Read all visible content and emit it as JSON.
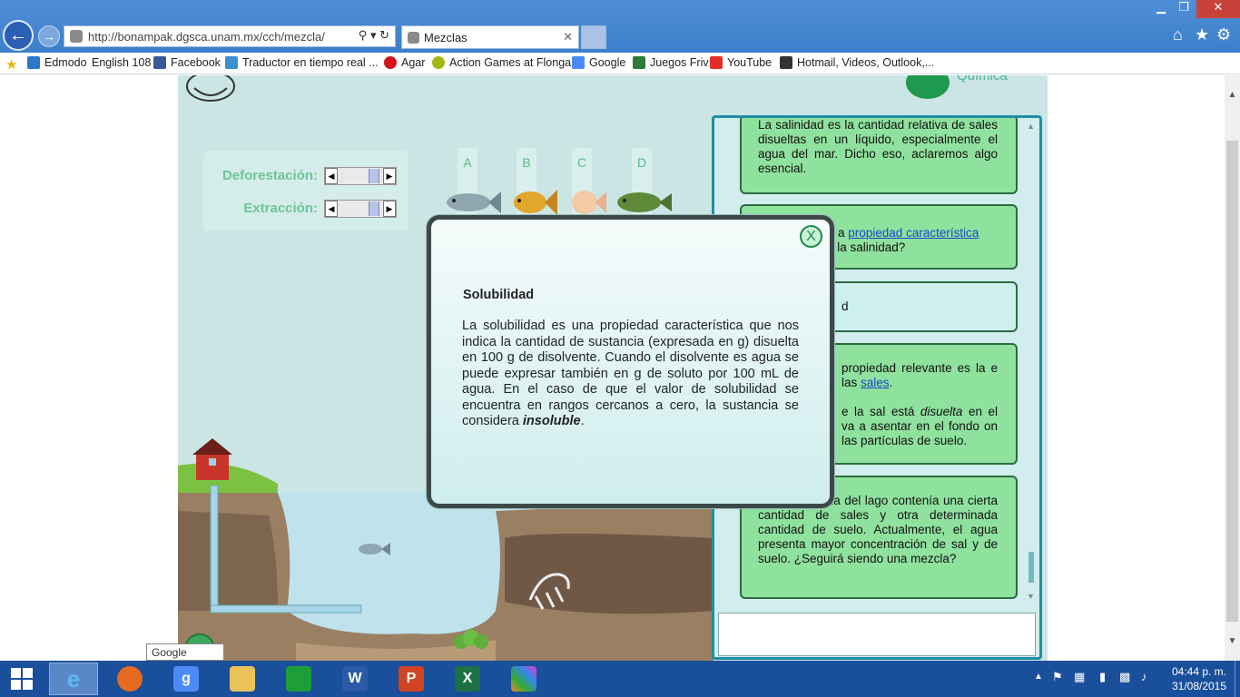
{
  "browser": {
    "address": "http://bonampak.dgsca.unam.mx/cch/mezcla/",
    "tab_title": "Mezclas",
    "window_controls": {
      "minimize": "▁",
      "maximize": "❐",
      "close": "✕"
    },
    "favorites": [
      {
        "label": "Edmodo",
        "color": "#2b76c9"
      },
      {
        "label": "English 108",
        "color": "#ffffff"
      },
      {
        "label": "Facebook",
        "color": "#3b5998"
      },
      {
        "label": "Traductor en tiempo real ...",
        "color": "#3a8fd0"
      },
      {
        "label": "Agar",
        "color": "#d6101e"
      },
      {
        "label": "Action Games at Flonga",
        "color": "#a4b814"
      },
      {
        "label": "Google",
        "color": "#4c8bf5"
      },
      {
        "label": "Juegos Friv",
        "color": "#2a7b3c"
      },
      {
        "label": "YouTube",
        "color": "#e52d27"
      },
      {
        "label": "Hotmail, Videos, Outlook,...",
        "color": "#333333"
      }
    ]
  },
  "app": {
    "header_text": "Química",
    "controls": {
      "deforestation_label": "Deforestación:",
      "extraction_label": "Extracción:"
    },
    "fish_labels": [
      "A",
      "B",
      "C",
      "D"
    ]
  },
  "chat": {
    "messages": [
      {
        "kind": "bot",
        "html": "La salinidad es la cantidad relativa de sales disueltas en un líquido, especialmente el agua del mar. Dicho eso, aclaremos algo esencial."
      },
      {
        "kind": "bot",
        "text_before": "a ",
        "link": "propiedad característica",
        "text_after": " n la salinidad?"
      },
      {
        "kind": "user",
        "text": "d"
      },
      {
        "kind": "bot",
        "p1_before": "propiedad relevante es la e las ",
        "p1_link": "sales",
        "p1_after": ".",
        "p2_before": "e la sal está ",
        "p2_em": "disuelta",
        "p2_after": " en el va a asentar en el fondo on las partículas de suelo."
      },
      {
        "kind": "bot",
        "html": "inicial del agua del lago contenía una cierta cantidad de sales y otra determinada cantidad de suelo. Actualmente, el agua presenta mayor concentración de sal y de suelo. ¿Seguirá siendo una mezcla?"
      }
    ],
    "input_value": ""
  },
  "modal": {
    "close_label": "X",
    "title": "Solubilidad",
    "body_text": "La solubilidad es una propiedad característica que nos indica la cantidad de sustancia (expresada en g) disuelta en 100 g de disolvente. Cuando el disolvente es agua se puede expresar también en g de soluto por 100 mL de agua. En el caso de que el valor de solubilidad se encuentra en rangos cercanos a cero, la sustancia se considera ",
    "body_em": "insoluble",
    "body_end": "."
  },
  "tooltip": "Google Search",
  "taskbar": {
    "apps": [
      "Internet Explorer",
      "Firefox",
      "Google",
      "File Explorer",
      "Store",
      "Word",
      "PowerPoint",
      "Excel",
      "Paint app"
    ],
    "time": "04:44 p. m.",
    "date": "31/08/2015"
  }
}
